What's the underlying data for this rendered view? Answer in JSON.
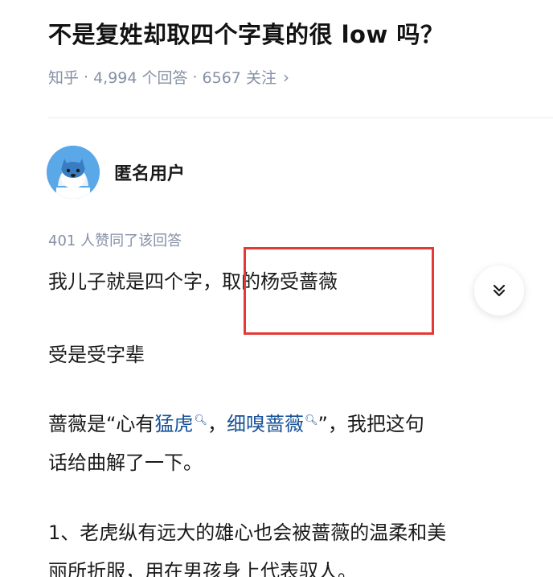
{
  "question": {
    "title": "不是复姓却取四个字真的很 low 吗？",
    "source": "知乎",
    "answers": "4,994 个回答",
    "follows": "6567 关注",
    "separator": "·",
    "chevron_icon": "chevron-right-icon"
  },
  "answer": {
    "author_name": "匿名用户",
    "avatar_icon": "anonymous-avatar-icon",
    "vote_text": "401 人赞同了该回答",
    "expand_icon": "double-chevron-down-icon",
    "paragraphs": {
      "p1": "我儿子就是四个字，取的杨受蔷薇",
      "p2": "受是受字辈",
      "p3_prefix": "蔷薇是“心有",
      "p3_link1": "猛虎",
      "p3_mid": "，",
      "p3_link2": "细嗅蔷薇",
      "p3_suffix": "”，我把这句",
      "p3_line2": "话给曲解了一下。",
      "p4_line1": "1、老虎纵有远大的雄心也会被蔷薇的温柔和美",
      "p4_line2": "丽所折服，用在男孩身上代表驭人。"
    }
  },
  "colors": {
    "highlight_box": "#e53935",
    "link": "#175199",
    "meta": "#8590a6"
  }
}
